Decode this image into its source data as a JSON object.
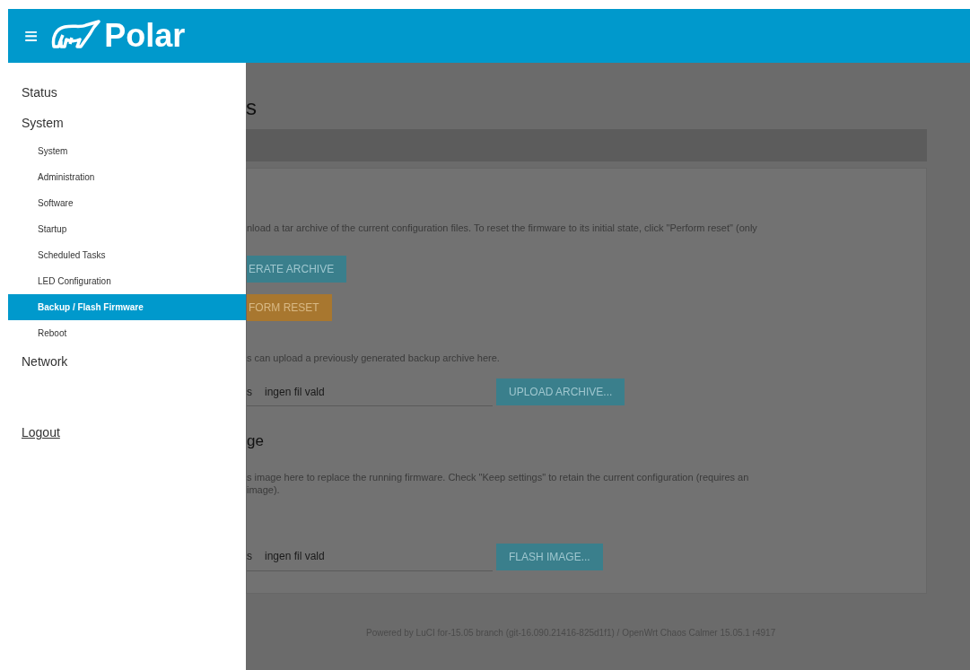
{
  "header": {
    "menu_icon": "≡",
    "brand": "Polar"
  },
  "drawer": {
    "items": [
      {
        "label": "Status",
        "selected": false
      },
      {
        "label": "System",
        "selected": false,
        "children": [
          {
            "label": "System",
            "selected": false
          },
          {
            "label": "Administration",
            "selected": false
          },
          {
            "label": "Software",
            "selected": false
          },
          {
            "label": "Startup",
            "selected": false
          },
          {
            "label": "Scheduled Tasks",
            "selected": false
          },
          {
            "label": "LED Configuration",
            "selected": false
          },
          {
            "label": "Backup / Flash Firmware",
            "selected": true
          },
          {
            "label": "Reboot",
            "selected": false
          }
        ]
      },
      {
        "label": "Network",
        "selected": false
      }
    ],
    "logout": "Logout"
  },
  "page": {
    "title": "s",
    "backup": {
      "description": "nload a tar archive of the current configuration files. To reset the firmware to its initial state, click \"Perform reset\" (only",
      "buttons": [
        {
          "label": "ERATE ARCHIVE",
          "kind": "primary"
        },
        {
          "label": "FORM RESET",
          "kind": "warning"
        }
      ]
    },
    "restore": {
      "description": "s can upload a previously generated backup archive here.",
      "file_prefix": "s",
      "file_value": "ingen fil vald",
      "button": "UPLOAD ARCHIVE..."
    },
    "flash": {
      "title": "ge",
      "description": "s image here to replace the running firmware. Check \"Keep settings\" to retain the current configuration (requires an",
      "description_2": "image).",
      "file_prefix": "s",
      "file_value": "ingen fil vald",
      "button": "FLASH IMAGE..."
    },
    "footer": "Powered by LuCI for-15.05 branch (git-16.090.21416-825d1f1) / OpenWrt Chaos Calmer 15.05.1 r4917"
  }
}
